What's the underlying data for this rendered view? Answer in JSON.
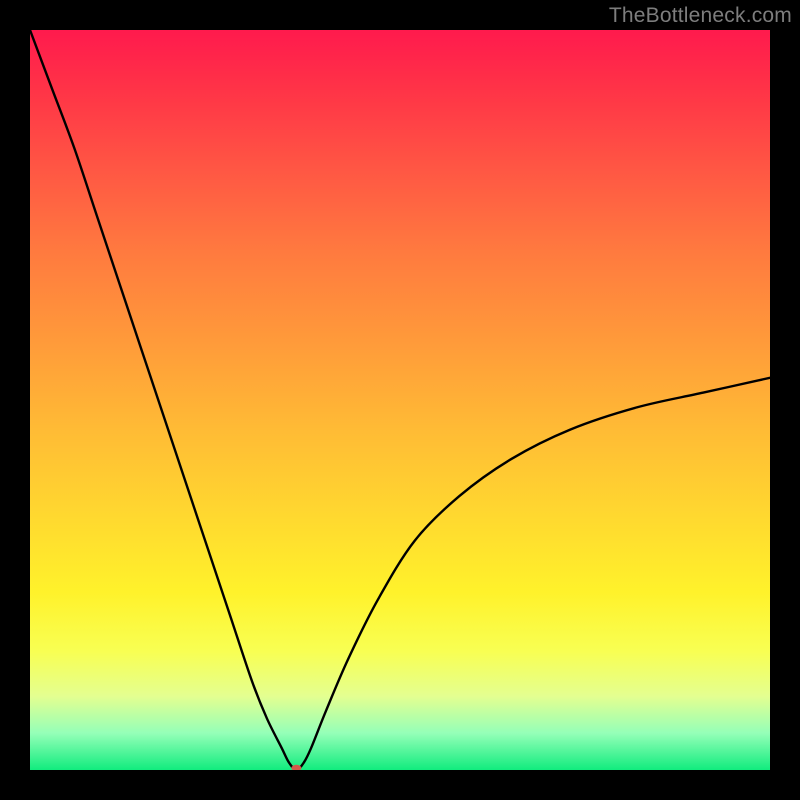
{
  "watermark": "TheBottleneck.com",
  "chart_data": {
    "type": "line",
    "title": "",
    "xlabel": "",
    "ylabel": "",
    "xlim": [
      0,
      100
    ],
    "ylim": [
      0,
      100
    ],
    "gradient_stops": [
      {
        "pos": 0,
        "color": "#ff1a4d"
      },
      {
        "pos": 8,
        "color": "#ff3347"
      },
      {
        "pos": 18,
        "color": "#ff5444"
      },
      {
        "pos": 30,
        "color": "#ff7a3f"
      },
      {
        "pos": 42,
        "color": "#ff9a3a"
      },
      {
        "pos": 54,
        "color": "#ffbb35"
      },
      {
        "pos": 66,
        "color": "#ffd92f"
      },
      {
        "pos": 76,
        "color": "#fff22b"
      },
      {
        "pos": 84,
        "color": "#f8ff53"
      },
      {
        "pos": 90,
        "color": "#e4ff90"
      },
      {
        "pos": 95,
        "color": "#95ffb8"
      },
      {
        "pos": 100,
        "color": "#11ec7e"
      }
    ],
    "series": [
      {
        "name": "bottleneck-curve",
        "color": "#000000",
        "stroke_width": 2.4,
        "x": [
          0,
          3,
          6,
          9,
          12,
          15,
          18,
          21,
          24,
          27,
          30,
          32,
          34,
          35,
          36,
          37,
          38,
          40,
          43,
          47,
          52,
          58,
          65,
          73,
          82,
          91,
          100
        ],
        "y": [
          100,
          92,
          84,
          75,
          66,
          57,
          48,
          39,
          30,
          21,
          12,
          7,
          3,
          1,
          0,
          1,
          3,
          8,
          15,
          23,
          31,
          37,
          42,
          46,
          49,
          51,
          53
        ]
      }
    ],
    "marker": {
      "name": "optimal-point",
      "x": 36,
      "y": 0,
      "color": "#d35a4a",
      "rx": 5,
      "ry": 3.2
    }
  }
}
